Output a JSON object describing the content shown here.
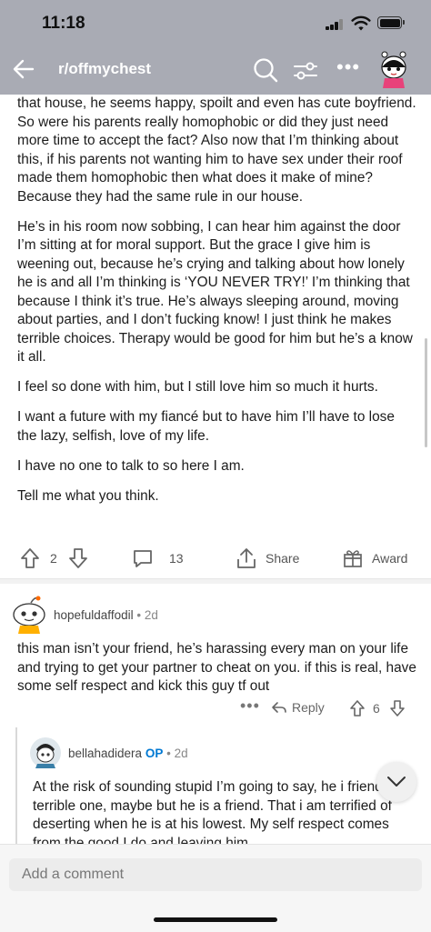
{
  "status_bar": {
    "time": "11:18"
  },
  "nav": {
    "subreddit": "r/offmychest"
  },
  "post": {
    "paragraphs": [
      "that house, he seems happy, spoilt and even has cute boyfriend. So were his parents really homophobic or did they just need more time to accept the fact? Also now that I’m thinking about this, if his parents not wanting him to have sex under their roof made them homophobic then what does it make of mine? Because they had the same rule in our house.",
      "He’s in his room now sobbing, I can hear him against the door I’m sitting at for moral support. But the grace I give him is weening out, because he’s crying and talking about how lonely he is and all I’m thinking is ‘YOU NEVER TRY!’ I’m thinking that because I think it’s true. He’s always sleeping around, moving about parties, and I don’t fucking know! I just think he makes terrible choices. Therapy would be good for him but he’s a know it all.",
      "I feel so done with him, but I still love him so much it hurts.",
      "I want a future with my fiancé but to have him I’ll have to lose the lazy, selfish, love of my life.",
      "I have no one to talk to so here I am.",
      "Tell me what you think."
    ],
    "vote_count": "2",
    "comment_count": "13",
    "share_label": "Share",
    "award_label": "Award"
  },
  "comments": [
    {
      "username": "hopefuldaffodil",
      "separator": "•",
      "age": "2d",
      "text": "this man isn’t your friend, he’s harassing every man on your life and trying to get your partner to cheat on you. if this is real, have some self respect and kick this guy tf out",
      "more": "•••",
      "reply_label": "Reply",
      "vote_count": "6"
    },
    {
      "username": "bellahadidera",
      "op_badge": "OP",
      "separator": "•",
      "age": "2d",
      "text": "At the risk of sounding stupid I’m going to say, he i friend. A terrible one, maybe but he is a friend. That i am terrified of deserting when he is at his lowest. My self respect comes from the good I do and leaving him"
    }
  ],
  "bottom_bar": {
    "placeholder": "Add a comment"
  }
}
